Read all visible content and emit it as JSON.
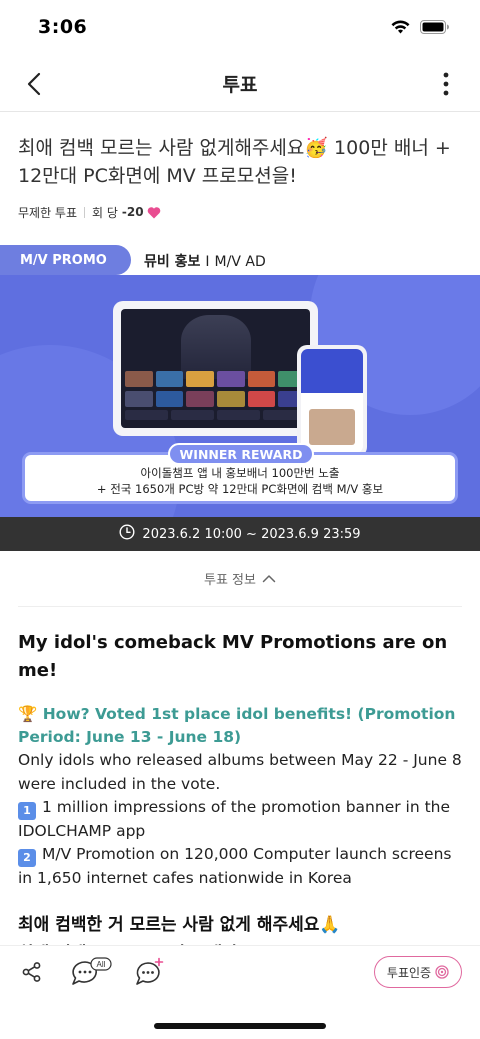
{
  "status_bar": {
    "time": "3:06"
  },
  "nav": {
    "title": "투표"
  },
  "vote": {
    "title": "최애 컴백 모르는 사람 없게해주세요🥳 100만 배너 + 12만대 PC화면에 MV 프로모션을!",
    "meta": {
      "type": "무제한 투표",
      "per_vote_label": "회 당",
      "cost": "-20"
    }
  },
  "promo": {
    "tab_label": "M/V PROMO",
    "subtitle_kr": "뮤비 홍보",
    "subtitle_sep": "I",
    "subtitle_en": "M/V AD",
    "reward_label": "WINNER REWARD",
    "reward_line1": "아이돌챔프 앱 내 홍보배너 100만번 노출",
    "reward_line2": "+ 전국 1650개 PC방 약 12만대 PC화면에 컴백 M/V 홍보"
  },
  "period": "2023.6.2 10:00 ~ 2023.6.9 23:59",
  "info_toggle": "투표 정보",
  "description": {
    "heading": "My idol's comeback MV Promotions are on me!",
    "highlight": "🏆 How? Voted 1st place idol benefits! (Promotion Period: June 13 - June 18)",
    "eligibility": "Only idols who released albums between May 22 - June 8 were included in the vote.",
    "benefit1_num": "1",
    "benefit1": "1 million impressions of the promotion banner in the IDOLCHAMP app",
    "benefit2_num": "2",
    "benefit2": "M/V Promotion on 120,000 Computer launch screens in 1,650 internet cafes nationwide in Korea",
    "korean_line1": "최애 컴백한 거 모르는 사람 없게 해주세요🙏",
    "korean_line2": "최애 컴백 MV프로모션은 내가!"
  },
  "bottom_bar": {
    "comment_all_badge": "All",
    "verify_label": "투표인증"
  },
  "colors": {
    "promo_blue": "#5f6fe0",
    "tab_blue": "#6e7ee0",
    "highlight_teal": "#3d9b94",
    "heart_pink": "#e94d91",
    "verify_pink": "#e0699f"
  }
}
